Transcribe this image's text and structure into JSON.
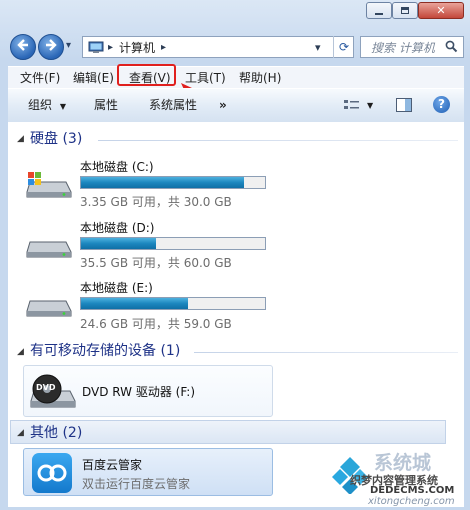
{
  "window": {
    "caption_minimize": "▭",
    "caption_maximize": "□",
    "caption_close": "✕"
  },
  "navigation": {
    "back_glyph": "◀",
    "forward_glyph": "▶",
    "history_glyph": "▾",
    "address_segment": "计算机",
    "address_sep_1": "▸",
    "address_sep_2": "▸",
    "address_dropdown": "▾",
    "refresh_glyph": "⟳",
    "search_placeholder": "搜索 计算机",
    "search_icon": "magnifier-icon"
  },
  "menu": {
    "file": "文件(F)",
    "edit": "编辑(E)",
    "view": "查看(V)",
    "tools": "工具(T)",
    "help": "帮助(H)"
  },
  "toolbar": {
    "organize": "组织",
    "organize_caret": "▼",
    "properties": "属性",
    "system_properties": "系统属性",
    "more": "»",
    "views_caret": "▼",
    "help_glyph": "?"
  },
  "groups": {
    "hard_disks": "硬盘 (3)",
    "removable": "有可移动存储的设备 (1)",
    "other": "其他 (2)",
    "collapse_glyph": "◢"
  },
  "drives": [
    {
      "name": "本地磁盘 (C:)",
      "free_text": "3.35 GB 可用，共 30.0 GB",
      "used_fraction": 0.888,
      "system_drive": true
    },
    {
      "name": "本地磁盘 (D:)",
      "free_text": "35.5 GB 可用，共 60.0 GB",
      "used_fraction": 0.408,
      "system_drive": false
    },
    {
      "name": "本地磁盘 (E:)",
      "free_text": "24.6 GB 可用，共 59.0 GB",
      "used_fraction": 0.583,
      "system_drive": false
    }
  ],
  "removable_devices": [
    {
      "name": "DVD RW 驱动器 (F:)",
      "badge": "DVD"
    }
  ],
  "other_items": [
    {
      "name": "百度云管家",
      "subtitle": "双击运行百度云管家"
    }
  ],
  "watermark": {
    "line1": "系统城",
    "line2": "织梦内容管理系统",
    "line3": "DEDECMS.COM",
    "line4": "xitongcheng.com"
  },
  "colors": {
    "annotation_red": "#e0201e",
    "bar_fill": "#1c87bf",
    "group_header_blue": "#1e3287"
  }
}
